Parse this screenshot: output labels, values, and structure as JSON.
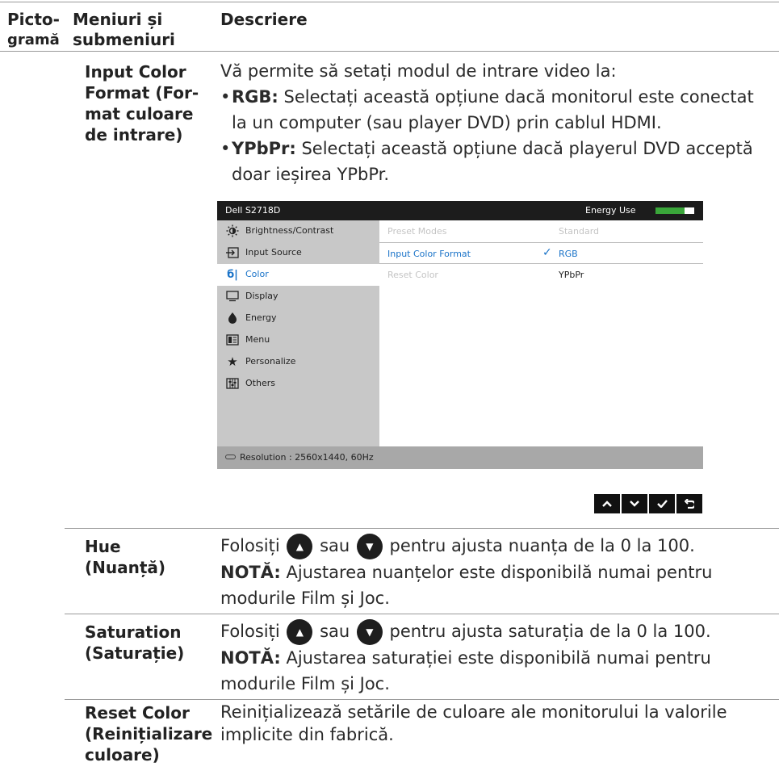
{
  "header": {
    "col_icon_line1": "Picto-",
    "col_icon_line2": "gramă",
    "col_menu_line1": "Meniuri și",
    "col_menu_line2": "submeniuri",
    "col_desc": "Descriere"
  },
  "input_color": {
    "name_lines": [
      "Input Color",
      "Format (For-",
      "mat culoare",
      "de intrare)"
    ],
    "intro": "Vă permite să setați modul de intrare video la:",
    "bullet1_label": "RGB:",
    "bullet1_text_line1": " Selectați această opțiune dacă monitorul este conectat",
    "bullet1_text_line2": "la un computer (sau player DVD) prin cablul HDMI.",
    "bullet2_label": "YPbPr:",
    "bullet2_text_line1": " Selectați această opțiune dacă playerul DVD acceptă",
    "bullet2_text_line2": "doar ieșirea YPbPr."
  },
  "osd": {
    "model": "Dell S2718D",
    "energy_label": "Energy Use",
    "energy_level": 0.75,
    "menu_items": [
      {
        "label": "Brightness/Contrast",
        "icon": "brightness-icon"
      },
      {
        "label": "Input Source",
        "icon": "input-source-icon"
      },
      {
        "label": "Color",
        "icon": "color-icon"
      },
      {
        "label": "Display",
        "icon": "display-icon"
      },
      {
        "label": "Energy",
        "icon": "energy-icon"
      },
      {
        "label": "Menu",
        "icon": "menu-icon"
      },
      {
        "label": "Personalize",
        "icon": "star-icon"
      },
      {
        "label": "Others",
        "icon": "others-icon"
      }
    ],
    "selected_item": "Color",
    "rows": [
      {
        "label": "Preset Modes",
        "value": "Standard"
      },
      {
        "label": "Input Color Format",
        "value": "RGB"
      },
      {
        "label": "Reset Color",
        "value": "YPbPr"
      }
    ],
    "footer": "Resolution : 2560x1440, 60Hz",
    "colors": {
      "accent": "#1a73c8",
      "energy_bar": "#3aa63a",
      "title_bar": "#1c1c1c",
      "menu_bg": "#c8c8c8"
    }
  },
  "nav_buttons": [
    {
      "name": "up-button",
      "glyph": "⌃"
    },
    {
      "name": "down-button",
      "glyph": "⌄"
    },
    {
      "name": "ok-button",
      "glyph": "✓"
    },
    {
      "name": "back-button",
      "glyph": "↶"
    }
  ],
  "hue": {
    "name_line1": "Hue",
    "name_line2": "(Nuanță)",
    "text_a": "Folosiți ",
    "text_b": " sau ",
    "text_c": " pentru ajusta nuanța de la 0 la 100.",
    "note_label": "NOTĂ:",
    "note_line1": " Ajustarea nuanțelor este disponibilă numai pentru",
    "note_line2": "modurile Film și Joc."
  },
  "saturation": {
    "name_line1": "Saturation",
    "name_line2": "(Saturație)",
    "text_a": "Folosiți ",
    "text_b": " sau ",
    "text_c": "  pentru ajusta saturația de la 0 la 100.",
    "note_label": "NOTĂ:",
    "note_line1": " Ajustarea saturației este disponibilă numai pentru",
    "note_line2": "modurile Film și Joc."
  },
  "reset_color": {
    "name_line1": "Reset Color",
    "name_line2": "(Reinițializare",
    "name_line3": "culoare)",
    "desc_line1": "Reinițializează setările de culoare ale monitorului la valorile",
    "desc_line2": "implicite din fabrică."
  }
}
